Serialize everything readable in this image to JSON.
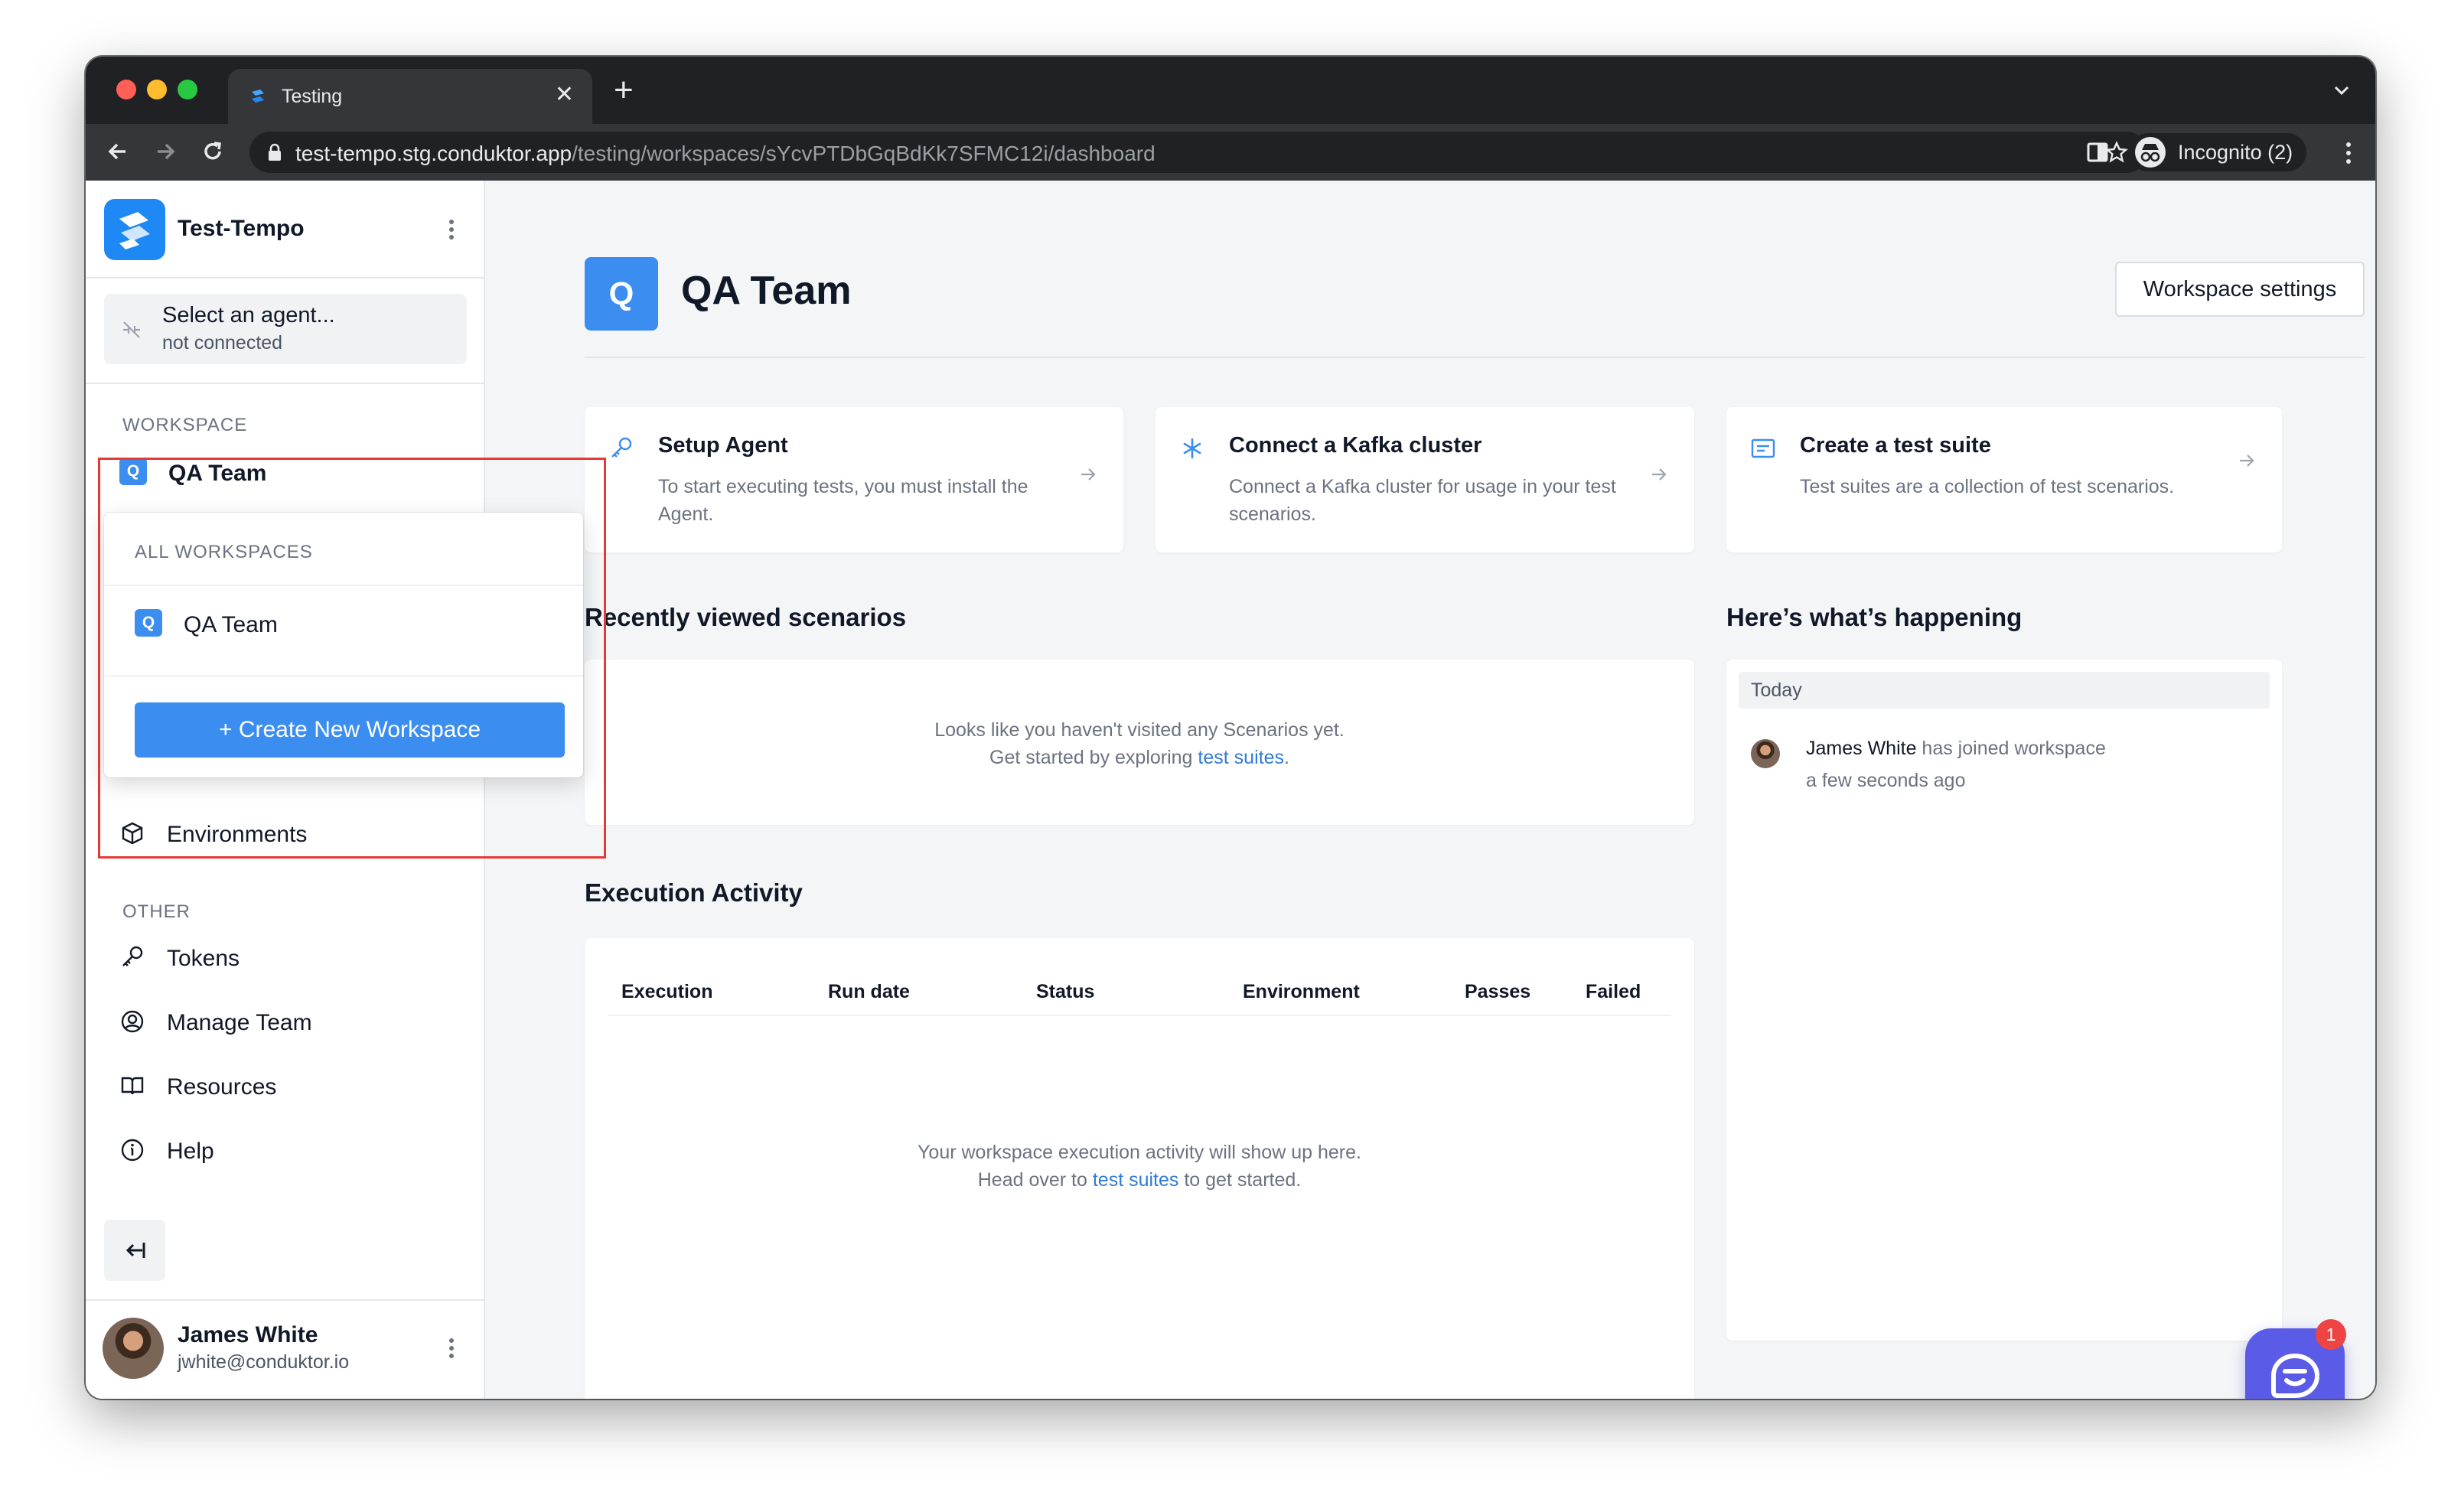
{
  "browser": {
    "tab_title": "Testing",
    "url_host": "test-tempo.stg.conduktor.app",
    "url_path": "/testing/workspaces/sYcvPTDbGqBdKk7SFMC12i/dashboard",
    "incognito_label": "Incognito (2)"
  },
  "sidebar": {
    "org_name": "Test-Tempo",
    "agent": {
      "title": "Select an agent...",
      "status": "not connected"
    },
    "workspace_section_label": "WORKSPACE",
    "current_workspace": {
      "badge": "Q",
      "name": "QA Team"
    },
    "partial_item": "Environments",
    "other_section_label": "OTHER",
    "other_items": [
      {
        "label": "Tokens",
        "icon": "key-icon"
      },
      {
        "label": "Manage Team",
        "icon": "user-circle-icon"
      },
      {
        "label": "Resources",
        "icon": "book-icon"
      },
      {
        "label": "Help",
        "icon": "info-icon"
      }
    ],
    "user": {
      "name": "James White",
      "email": "jwhite@conduktor.io"
    }
  },
  "workspace_dropdown": {
    "label": "ALL WORKSPACES",
    "items": [
      {
        "badge": "Q",
        "name": "QA Team"
      }
    ],
    "create_label": "Create New Workspace",
    "create_icon": "+"
  },
  "main": {
    "workspace_badge": "Q",
    "workspace_title": "QA Team",
    "settings_button": "Workspace settings",
    "quick_cards": [
      {
        "title": "Setup Agent",
        "description": "To start executing tests, you must install the Agent.",
        "icon": "key-icon"
      },
      {
        "title": "Connect a Kafka cluster",
        "description": "Connect a Kafka cluster for usage in your test scenarios.",
        "icon": "asterisk-icon"
      },
      {
        "title": "Create a test suite",
        "description": "Test suites are a collection of test scenarios.",
        "icon": "list-icon"
      }
    ],
    "recent": {
      "title": "Recently viewed scenarios",
      "empty_line1": "Looks like you haven't visited any Scenarios yet.",
      "empty_line2_prefix": "Get started by exploring ",
      "empty_line2_link": "test suites",
      "empty_line2_suffix": "."
    },
    "execution": {
      "title": "Execution Activity",
      "columns": [
        "Execution",
        "Run date",
        "Status",
        "Environment",
        "Passes",
        "Failed"
      ],
      "empty_line1": "Your workspace execution activity will show up here.",
      "empty_line2_prefix": "Head over to ",
      "empty_line2_link": "test suites",
      "empty_line2_suffix": " to get started."
    },
    "happening": {
      "title": "Here’s what’s happening",
      "group_label": "Today",
      "activity": {
        "actor": "James White",
        "action": " has joined workspace",
        "time": "a few seconds ago"
      }
    }
  },
  "chat": {
    "unread_count": "1"
  },
  "colors": {
    "accent": "#3b8ef0",
    "link": "#2f7bd8",
    "highlight": "#e53935",
    "chat": "#5a5be6"
  }
}
